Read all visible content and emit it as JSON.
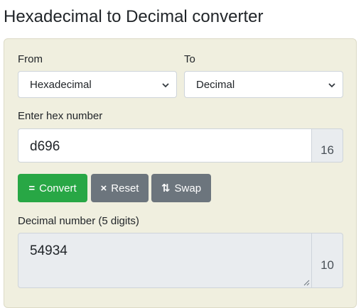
{
  "page": {
    "title": "Hexadecimal to Decimal converter"
  },
  "form": {
    "from_label": "From",
    "from_value": "Hexadecimal",
    "to_label": "To",
    "to_value": "Decimal",
    "input_label": "Enter hex number",
    "input_value": "d696",
    "input_base": "16",
    "output_label": "Decimal number (5 digits)",
    "output_value": "54934",
    "output_base": "10"
  },
  "buttons": {
    "convert_icon": "=",
    "convert_label": "Convert",
    "reset_icon": "×",
    "reset_label": "Reset",
    "swap_icon": "⇅",
    "swap_label": "Swap"
  },
  "colors": {
    "card_bg": "#f0efdf",
    "convert": "#28a745",
    "secondary": "#6c757d"
  }
}
